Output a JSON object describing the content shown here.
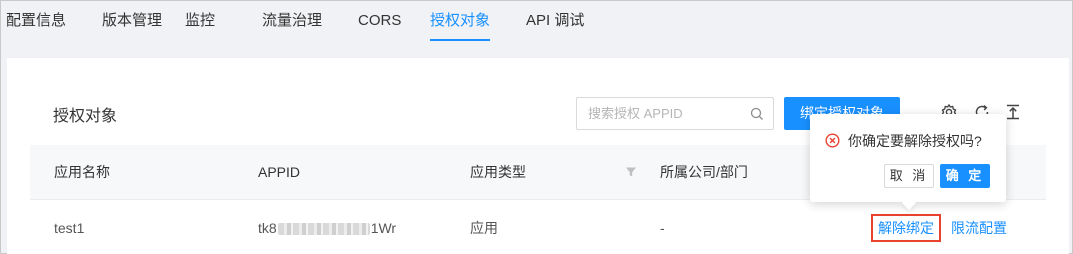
{
  "tabs": [
    {
      "label": "配置信息"
    },
    {
      "label": "版本管理"
    },
    {
      "label": "监控"
    },
    {
      "label": "流量治理"
    },
    {
      "label": "CORS"
    },
    {
      "label": "授权对象"
    },
    {
      "label": "API 调试"
    }
  ],
  "active_tab": "授权对象",
  "card": {
    "title": "授权对象",
    "search_placeholder": "搜索授权 APPID",
    "bind_button": "绑定授权对象"
  },
  "table": {
    "headers": [
      "应用名称",
      "APPID",
      "应用类型",
      "所属公司/部门"
    ],
    "rows": [
      {
        "name": "test1",
        "appid_prefix": "tk8",
        "appid_suffix": "1Wr",
        "type": "应用",
        "company": "-",
        "action_unbind": "解除绑定",
        "action_limit": "限流配置"
      }
    ]
  },
  "popconfirm": {
    "message": "你确定要解除授权吗?",
    "cancel": "取 消",
    "ok": "确 定"
  },
  "colors": {
    "accent": "#1890ff",
    "danger": "#e8432e"
  }
}
